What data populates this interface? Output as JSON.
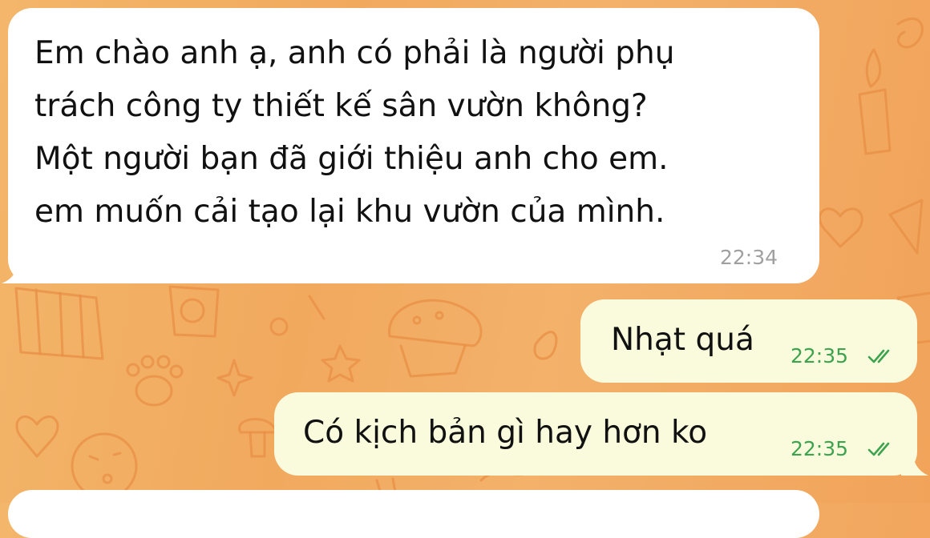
{
  "conversation": {
    "messages": [
      {
        "direction": "incoming",
        "lines": [
          "Em chào anh ạ, anh có phải là người phụ",
          "trách công ty thiết kế sân vườn không?",
          "Một người bạn đã giới thiệu anh cho em.",
          "em muốn cải tạo lại khu vườn của mình."
        ],
        "time": "22:34"
      },
      {
        "direction": "outgoing",
        "text": "Nhạt quá",
        "time": "22:35",
        "status": "read-double-check"
      },
      {
        "direction": "outgoing",
        "text": "Có kịch bản gì hay hơn ko",
        "time": "22:35",
        "status": "read-double-check"
      }
    ]
  },
  "theme": {
    "incoming_bubble": "#ffffff",
    "outgoing_bubble": "#fafbdd",
    "time_incoming": "#a0a0a0",
    "time_outgoing": "#3ea34f",
    "background": "#f2ad63",
    "doodle": "#e88f45"
  },
  "icons": {
    "read_status": "double-check-icon",
    "background_pattern": "doodle-pattern"
  }
}
